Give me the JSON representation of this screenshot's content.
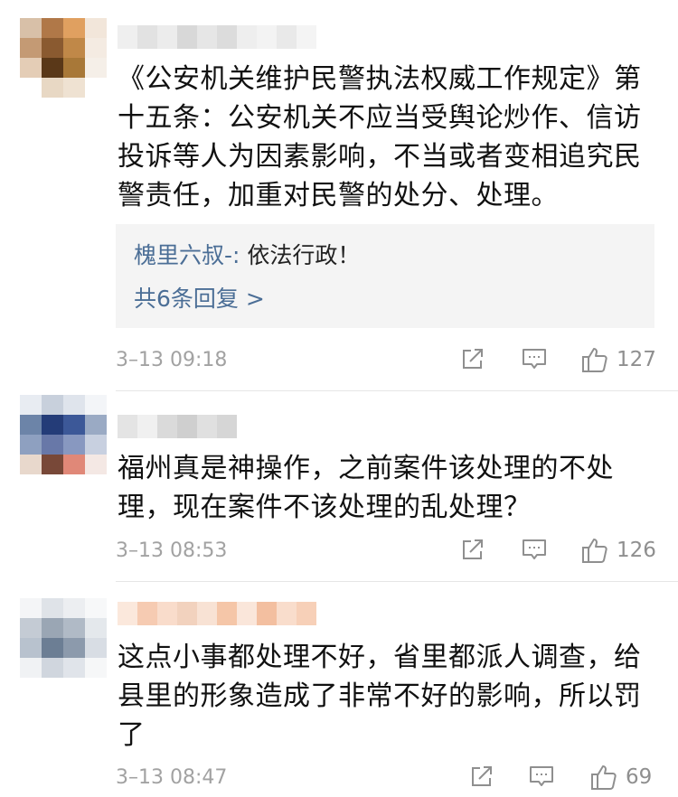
{
  "comments": [
    {
      "text": "《公安机关维护民警执法权威工作规定》第十五条：公安机关不应当受舆论炒作、信访投诉等人为因素影响，不当或者变相追究民警责任，加重对民警的处分、处理。",
      "reply_author": "槐里六叔-:",
      "reply_text": "依法行政！",
      "reply_more": "共6条回复 >",
      "timestamp": "3–13 09:18",
      "likes": "127"
    },
    {
      "text": "福州真是神操作，之前案件该处理的不处理，现在案件不该处理的乱处理？",
      "timestamp": "3–13 08:53",
      "likes": "126"
    },
    {
      "text": "这点小事都处理不好，省里都派人调查，给县里的形象造成了非常不好的影响，所以罚了",
      "timestamp": "3–13 08:47",
      "likes": "69"
    }
  ],
  "icons": {
    "share": "share-icon",
    "reply": "comment-icon",
    "like": "thumbs-up-icon"
  },
  "colors": {
    "link": "#4b6e96",
    "meta": "#a2a2a2",
    "reply_bg": "#f4f4f4"
  }
}
